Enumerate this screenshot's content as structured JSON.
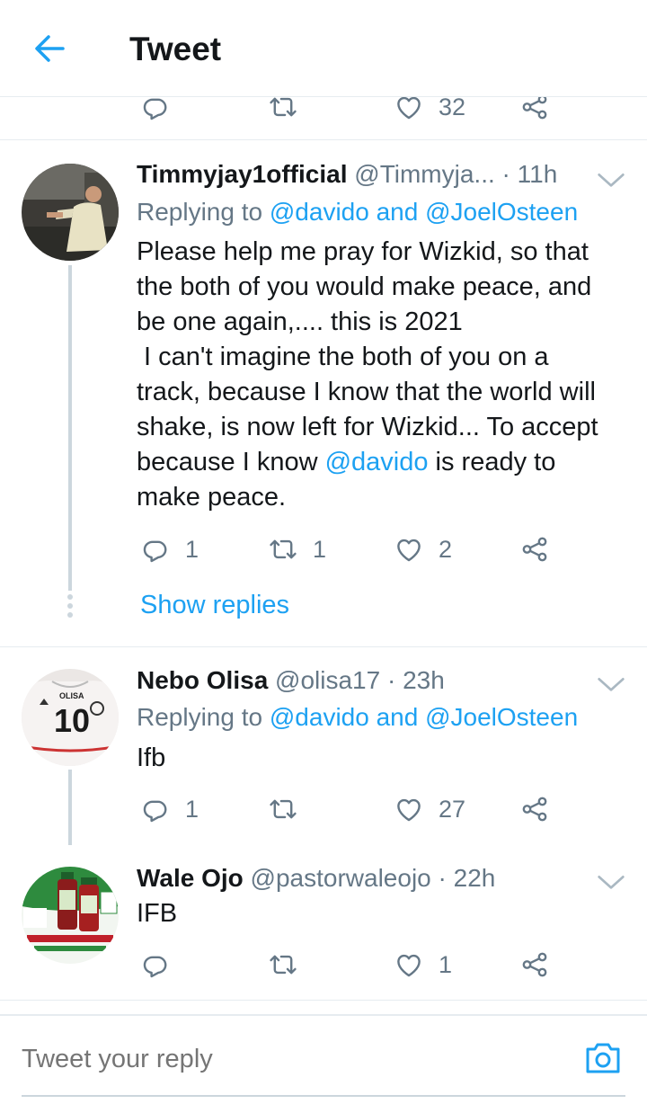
{
  "header": {
    "title": "Tweet"
  },
  "top_actions": {
    "like_count": "32"
  },
  "tweets": [
    {
      "name": "Timmyjay1official",
      "handle": "@Timmyja...",
      "sep": " · ",
      "time": "11h",
      "replying_prefix": "Replying to ",
      "replying_links": "@davido and @JoelOsteen",
      "text_lines": [
        "Please help me pray for Wizkid, so that",
        "the both of you would make peace, and",
        "be one again,.... this is 2021",
        " I can't imagine the both of you on a",
        "track, because I know that the world will",
        "shake, is now left for Wizkid... To accept"
      ],
      "text_line7_pre": "because I know ",
      "text_line7_mention": "@davido",
      "text_line7_post": " is ready to",
      "text_line8": "make peace.",
      "reply_count": "1",
      "retweet_count": "1",
      "like_count": "2",
      "show_replies": "Show replies"
    },
    {
      "name": "Nebo Olisa",
      "handle": "@olisa17",
      "sep": " · ",
      "time": "23h",
      "replying_prefix": "Replying to ",
      "replying_links": "@davido and @JoelOsteen",
      "text": "Ifb",
      "reply_count": "1",
      "retweet_count": "",
      "like_count": "27",
      "jersey_name": "OLISA",
      "jersey_number": "10"
    },
    {
      "name": "Wale Ojo",
      "handle": "@pastorwaleojo",
      "sep": " · ",
      "time": "22h",
      "text": "IFB",
      "reply_count": "",
      "retweet_count": "",
      "like_count": "1"
    }
  ],
  "reply_box": {
    "placeholder": "Tweet your reply"
  },
  "icons": {
    "back": "arrow-left-icon",
    "reply": "speech-bubble-icon",
    "retweet": "retweet-icon",
    "like": "heart-icon",
    "share": "share-icon",
    "caret": "chevron-down-icon",
    "camera": "camera-icon"
  },
  "colors": {
    "accent": "#1da1f2",
    "text_primary": "#14171a",
    "text_secondary": "#657786",
    "divider": "#e6ecf0"
  }
}
